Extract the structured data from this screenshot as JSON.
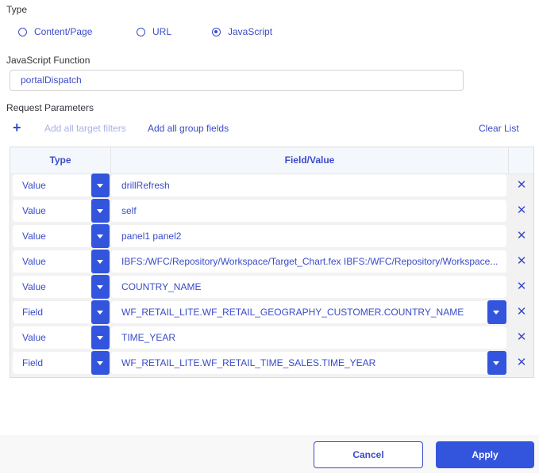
{
  "type_section": {
    "label": "Type",
    "options": [
      {
        "label": "Content/Page",
        "checked": false
      },
      {
        "label": "URL",
        "checked": false
      },
      {
        "label": "JavaScript",
        "checked": true
      }
    ]
  },
  "js_function": {
    "label": "JavaScript Function",
    "value": "portalDispatch"
  },
  "request_parameters": {
    "label": "Request Parameters",
    "add_icon": "plus-icon",
    "add_all_target_filters": "Add all target filters",
    "add_all_group_fields": "Add all group fields",
    "clear_list": "Clear List",
    "columns": {
      "type": "Type",
      "field_value": "Field/Value"
    },
    "rows": [
      {
        "type": "Value",
        "value": "drillRefresh",
        "has_field_dropdown": false
      },
      {
        "type": "Value",
        "value": "self",
        "has_field_dropdown": false
      },
      {
        "type": "Value",
        "value": "panel1 panel2",
        "has_field_dropdown": false
      },
      {
        "type": "Value",
        "value": "IBFS:/WFC/Repository/Workspace/Target_Chart.fex IBFS:/WFC/Repository/Workspace...",
        "has_field_dropdown": false
      },
      {
        "type": "Value",
        "value": "COUNTRY_NAME",
        "has_field_dropdown": false
      },
      {
        "type": "Field",
        "value": "WF_RETAIL_LITE.WF_RETAIL_GEOGRAPHY_CUSTOMER.COUNTRY_NAME",
        "has_field_dropdown": true
      },
      {
        "type": "Value",
        "value": "TIME_YEAR",
        "has_field_dropdown": false
      },
      {
        "type": "Field",
        "value": "WF_RETAIL_LITE.WF_RETAIL_TIME_SALES.TIME_YEAR",
        "has_field_dropdown": true
      }
    ],
    "remove_icon": "close-icon"
  },
  "footer": {
    "cancel": "Cancel",
    "apply": "Apply"
  },
  "colors": {
    "accent": "#3355dd",
    "text_accent": "#3a4bc9",
    "disabled_link": "#a9b1e6"
  }
}
